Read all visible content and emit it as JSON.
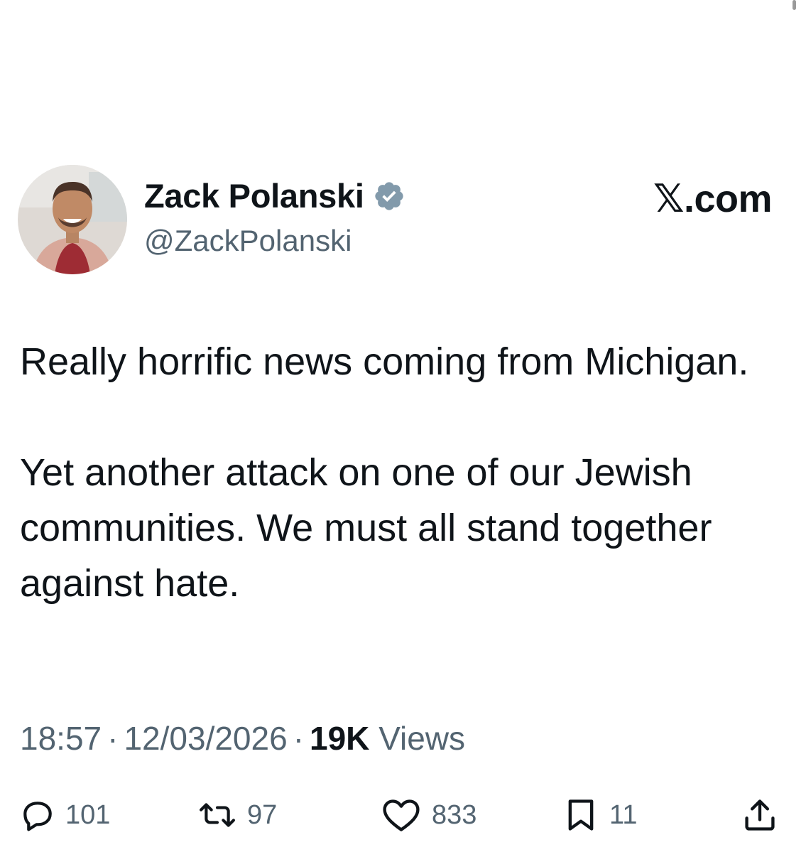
{
  "author": {
    "display_name": "Zack Polanski",
    "handle": "@ZackPolanski",
    "verified": true
  },
  "source_label": "𝕏.com",
  "tweet": {
    "paragraphs": [
      "Really horrific news coming from Michigan.",
      "Yet another attack on one of our Jewish communities. We must all stand together against hate."
    ]
  },
  "meta": {
    "time": "18:57",
    "separator": "·",
    "date": "12/03/2026",
    "views_count": "19K",
    "views_label": "Views"
  },
  "actions": {
    "reply": {
      "icon": "reply-icon",
      "count": "101"
    },
    "repost": {
      "icon": "repost-icon",
      "count": "97"
    },
    "like": {
      "icon": "heart-icon",
      "count": "833"
    },
    "bookmark": {
      "icon": "bookmark-icon",
      "count": "11"
    },
    "share": {
      "icon": "share-icon"
    }
  },
  "colors": {
    "text_primary": "#0f1419",
    "text_secondary": "#536471",
    "verified_badge": "#829aab",
    "background": "#ffffff"
  }
}
